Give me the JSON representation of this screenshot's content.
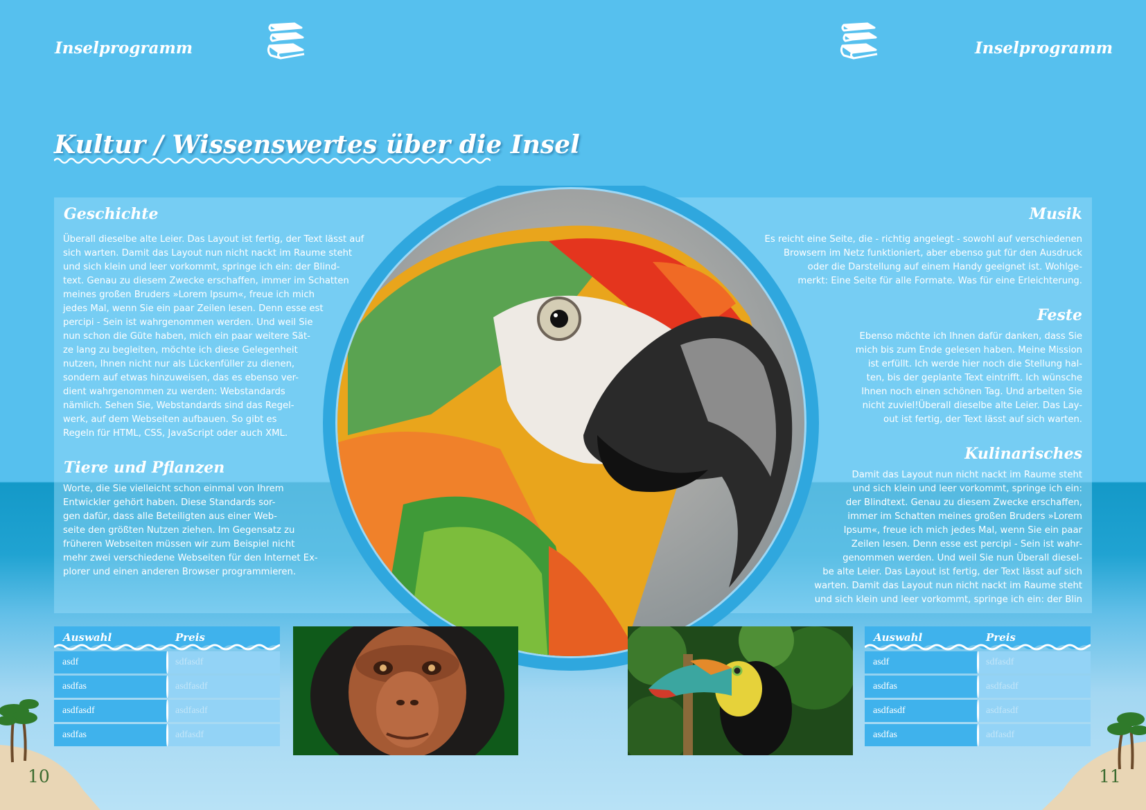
{
  "header": {
    "left_label": "Inselprogramm",
    "right_label": "Inselprogramm",
    "book_icon": "books-stack-icon"
  },
  "title": "Kultur / Wissenswertes über die Insel",
  "left": {
    "geschichte": {
      "heading": "Geschichte",
      "text": "Überall dieselbe alte Leier. Das Layout ist fertig, der Text lässt auf\nsich warten. Damit das Layout nun nicht nackt im Raume steht\nund sich klein und leer vorkommt, springe ich ein: der Blind-\ntext. Genau zu diesem Zwecke erschaffen, immer im Schatten\nmeines großen Bruders »Lorem Ipsum«, freue ich mich\njedes Mal, wenn Sie ein paar Zeilen lesen. Denn esse est\npercipi - Sein ist wahrgenommen werden. Und weil Sie\nnun schon die Güte haben, mich ein paar weitere Sät-\nze lang zu begleiten, möchte ich diese Gelegenheit\nnutzen, Ihnen nicht nur als Lückenfüller zu dienen,\nsondern auf etwas hinzuweisen, das es ebenso ver-\ndient wahrgenommen zu werden: Webstandards\nnämlich. Sehen Sie, Webstandards sind das Regel-\nwerk, auf dem Webseiten aufbauen. So gibt es\nRegeln für HTML, CSS, JavaScript oder auch XML."
    },
    "tiere": {
      "heading": "Tiere und Pflanzen",
      "text": "Worte, die Sie vielleicht schon einmal von Ihrem\nEntwickler gehört haben. Diese Standards sor-\ngen dafür, dass alle Beteiligten aus einer Web-\nseite den größten Nutzen ziehen. Im Gegensatz zu\nfrüheren Webseiten müssen wir zum Beispiel nicht\nmehr zwei verschiedene Webseiten für den Internet Ex-\nplorer und einen anderen Browser programmieren."
    }
  },
  "right": {
    "musik": {
      "heading": "Musik",
      "text": "Es reicht eine Seite, die - richtig angelegt - sowohl auf verschiedenen\nBrowsern im Netz funktioniert, aber ebenso gut für den Ausdruck\noder die Darstellung auf einem Handy geeignet ist. Wohlge-\nmerkt: Eine Seite für alle Formate. Was für eine Erleichterung."
    },
    "feste": {
      "heading": "Feste",
      "text": "Ebenso möchte ich Ihnen dafür danken, dass Sie\nmich bis zum Ende gelesen haben. Meine Mission\nist erfüllt. Ich werde hier noch die Stellung hal-\nten, bis der geplante Text eintrifft. Ich wünsche\nIhnen noch einen schönen Tag. Und arbeiten Sie\nnicht zuviel!Überall dieselbe alte Leier. Das Lay-\nout ist fertig, der Text lässt auf sich warten."
    },
    "kulinarisches": {
      "heading": "Kulinarisches",
      "text": "Damit das Layout nun nicht nackt im Raume steht\nund sich klein und leer vorkommt, springe ich ein:\nder Blindtext. Genau zu diesem Zwecke erschaffen,\nimmer im Schatten meines großen Bruders »Lorem\nIpsum«, freue ich mich jedes Mal, wenn Sie ein paar\nZeilen lesen. Denn esse est percipi - Sein ist wahr-\ngenommen werden. Und weil Sie nun Überall diesel-\nbe alte Leier. Das Layout ist fertig, der Text lässt auf sich\nwarten. Damit das Layout nun nicht nackt im Raume steht\nund sich klein und leer vorkommt, springe ich ein: der Blin"
    }
  },
  "table_left": {
    "col1": "Auswahl",
    "col2": "Preis",
    "rows": [
      [
        "asdf",
        "sdfasdf"
      ],
      [
        "asdfas",
        "asdfasdf"
      ],
      [
        "asdfasdf",
        "asdfasdf"
      ],
      [
        "asdfas",
        "adfasdf"
      ]
    ]
  },
  "table_right": {
    "col1": "Auswahl",
    "col2": "Preis",
    "rows": [
      [
        "asdf",
        "sdfasdf"
      ],
      [
        "asdfas",
        "asdfasdf"
      ],
      [
        "asdfasdf",
        "asdfasdf"
      ],
      [
        "asdfas",
        "adfasdf"
      ]
    ]
  },
  "images": {
    "center": "parrot-photo",
    "left": "chimpanzee-photo",
    "right": "toucan-photo"
  },
  "page_numbers": {
    "left": "10",
    "right": "11"
  }
}
